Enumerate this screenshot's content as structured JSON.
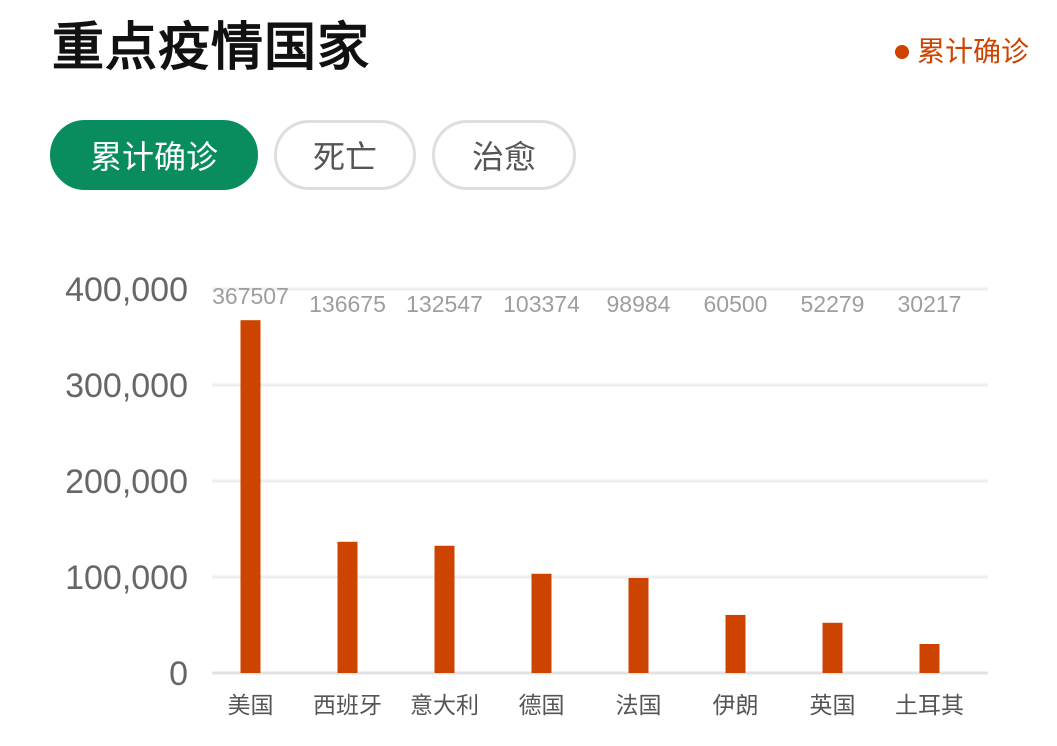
{
  "header": {
    "title": "重点疫情国家",
    "legend_label": "累计确诊",
    "legend_color": "#cc4400"
  },
  "tabs": [
    {
      "label": "累计确诊",
      "active": true
    },
    {
      "label": "死亡",
      "active": false
    },
    {
      "label": "治愈",
      "active": false
    }
  ],
  "colors": {
    "accent": "#0a8d5e",
    "bar": "#cc4400"
  },
  "chart_data": {
    "type": "bar",
    "categories": [
      "美国",
      "西班牙",
      "意大利",
      "德国",
      "法国",
      "伊朗",
      "英国",
      "土耳其"
    ],
    "values": [
      367507,
      136675,
      132547,
      103374,
      98984,
      60500,
      52279,
      30217
    ],
    "data_labels": [
      "367507",
      "136675",
      "132547",
      "103374",
      "98984",
      "60500",
      "52279",
      "30217"
    ],
    "yticks": [
      0,
      100000,
      200000,
      300000,
      400000
    ],
    "ytick_labels": [
      "0",
      "100,000",
      "200,000",
      "300,000",
      "400,000"
    ],
    "ylim": [
      0,
      400000
    ],
    "grid": true
  }
}
